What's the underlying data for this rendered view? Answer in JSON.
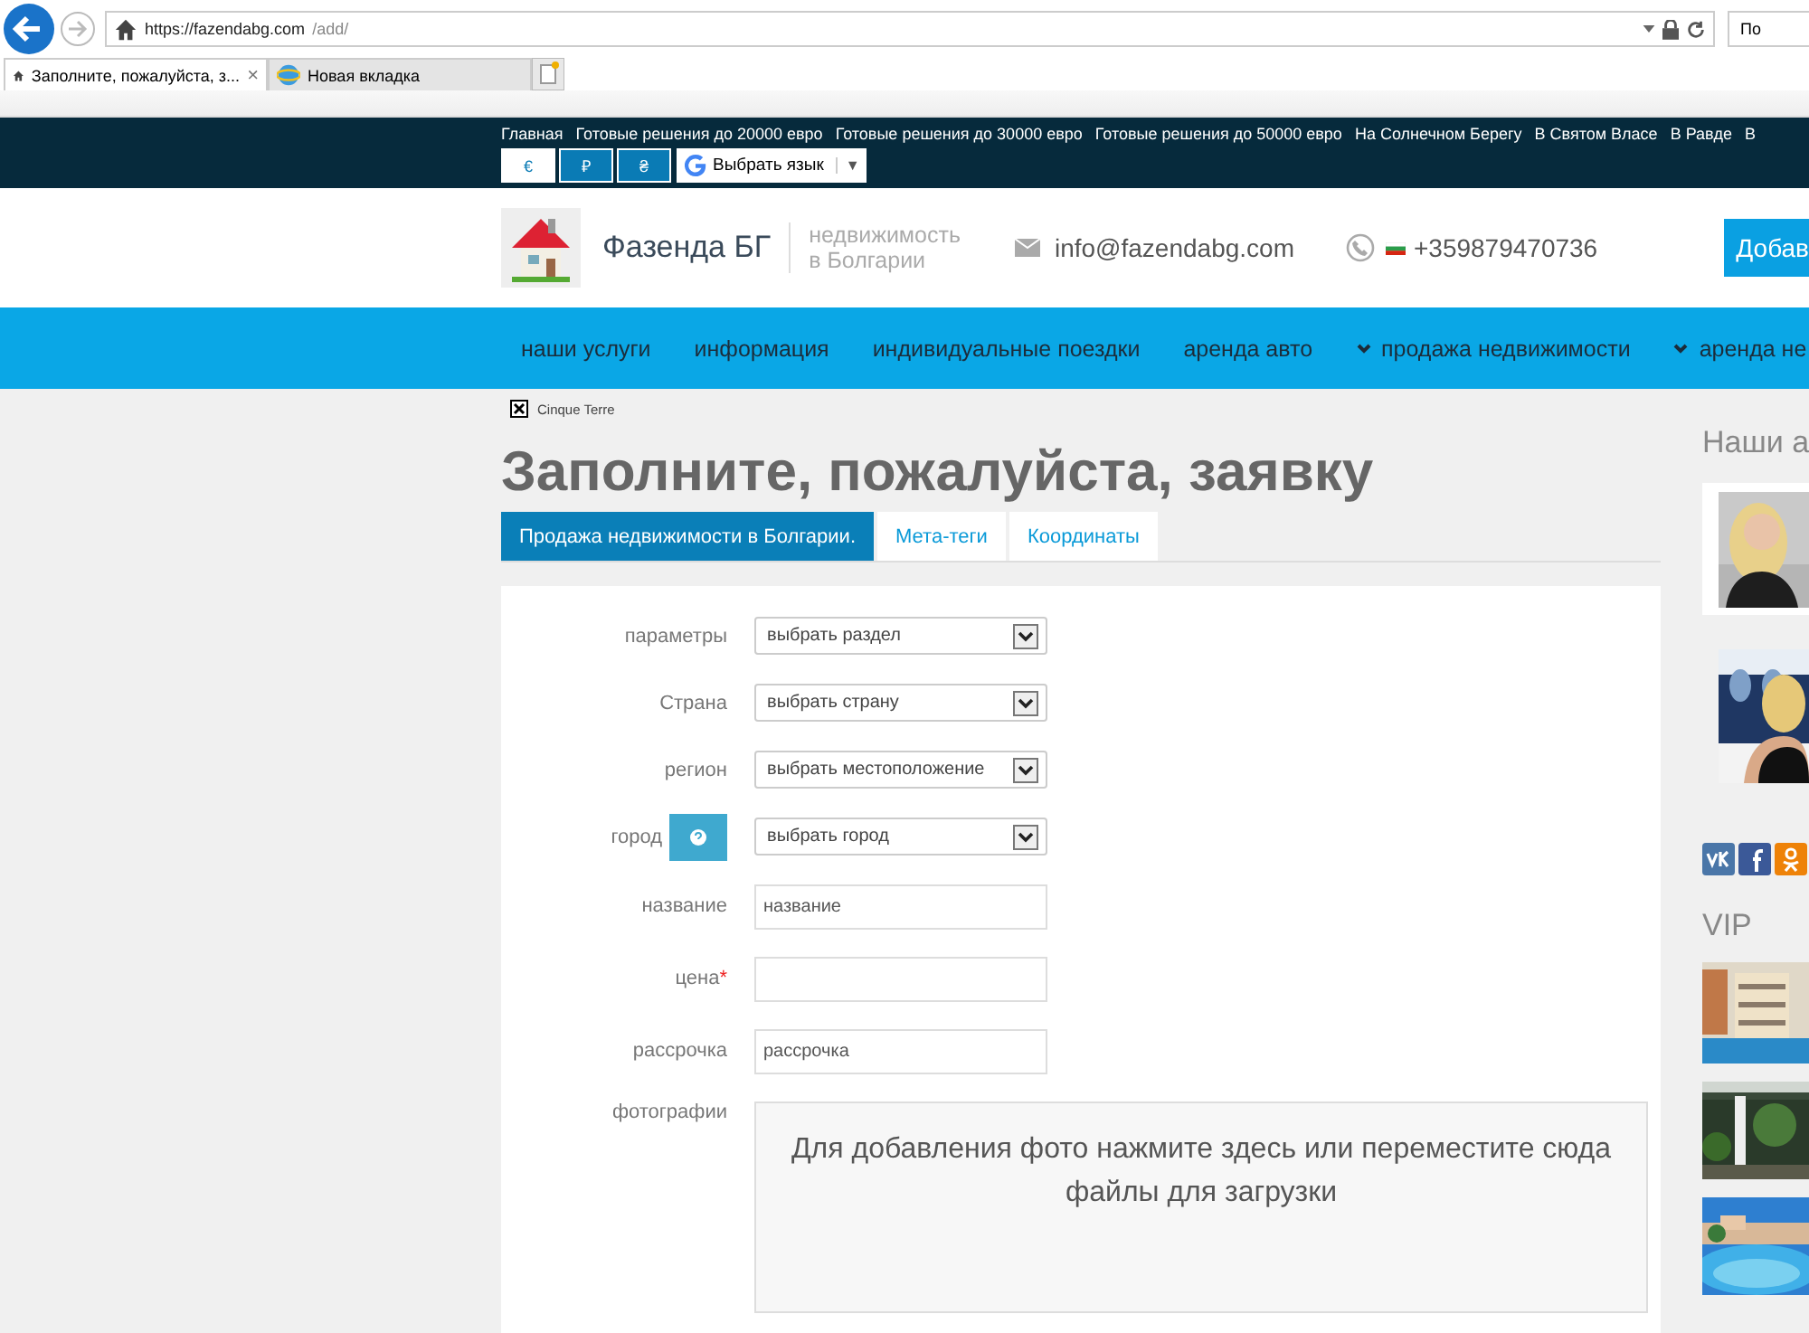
{
  "browser": {
    "url_host": "https://fazendabg.com",
    "url_path": "/add/",
    "search": "По",
    "tabs": [
      {
        "label": "Заполните, пожалуйста, з...",
        "close": "×",
        "selected": true
      },
      {
        "label": "Новая вкладка",
        "selected": false
      }
    ]
  },
  "top_links": [
    "Главная",
    "Готовые решения до 20000 евро",
    "Готовые решения до 30000 евро",
    "Готовые решения до 50000 евро",
    "На Солнечном Берегу",
    "В Святом Власе",
    "В Равде",
    "В"
  ],
  "currencies": [
    {
      "label": "€",
      "selected": true
    },
    {
      "label": "₽",
      "selected": false
    },
    {
      "label": "₴",
      "selected": false
    }
  ],
  "language": {
    "label": "Выбрать язык",
    "caret": "▼"
  },
  "header": {
    "brand": "Фазенда БГ",
    "tagline_1": "недвижимость",
    "tagline_2": "в Болгарии",
    "email": "info@fazendabg.com",
    "phone": "+359879470736",
    "button": "Добав"
  },
  "main_nav": [
    {
      "label": "наши услуги",
      "dropdown": false
    },
    {
      "label": "информация",
      "dropdown": false
    },
    {
      "label": "индивидуальные поездки",
      "dropdown": false
    },
    {
      "label": "аренда авто",
      "dropdown": false
    },
    {
      "label": "продажа недвижимости",
      "dropdown": true
    },
    {
      "label": "аренда не",
      "dropdown": true
    }
  ],
  "broken_image": "Cinque Terre",
  "title": "Заполните, пожалуйста, заявку",
  "form_tabs": [
    {
      "label": "Продажа недвижимости в Болгарии.",
      "selected": true
    },
    {
      "label": "Мета-теги",
      "selected": false
    },
    {
      "label": "Координаты",
      "selected": false
    }
  ],
  "fields": [
    {
      "kind": "select",
      "label": "параметры",
      "value": "выбрать раздел"
    },
    {
      "kind": "select",
      "label": "Страна",
      "value": "выбрать страну"
    },
    {
      "kind": "select",
      "label": "регион",
      "value": "выбрать местоположение"
    },
    {
      "kind": "select",
      "label": "город",
      "value": "выбрать город",
      "help": true
    },
    {
      "kind": "input",
      "label": "название",
      "placeholder": "название"
    },
    {
      "kind": "input",
      "label": "цена",
      "required_mark": "*"
    },
    {
      "kind": "input",
      "label": "рассрочка",
      "placeholder": "рассрочка"
    },
    {
      "kind": "upload",
      "label": "фотографии",
      "text": "Для добавления фото нажмите здесь или переместите сюда файлы для загрузки"
    }
  ],
  "sidebar": {
    "agents_heading": "Наши а",
    "vip_heading": "VIP"
  }
}
